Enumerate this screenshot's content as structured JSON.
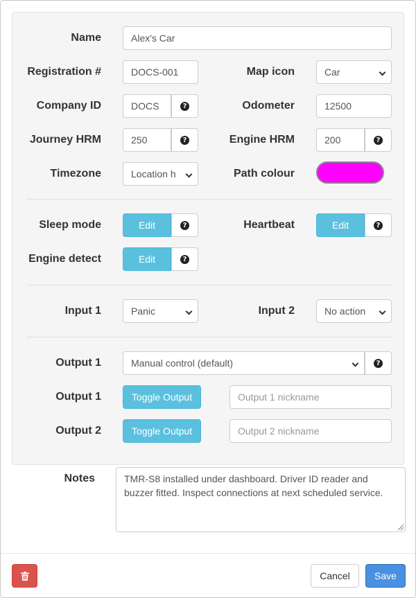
{
  "form": {
    "name": {
      "label": "Name",
      "value": "Alex's Car"
    },
    "registration": {
      "label": "Registration #",
      "value": "DOCS-001"
    },
    "map_icon": {
      "label": "Map icon",
      "selected": "Car"
    },
    "company_id": {
      "label": "Company ID",
      "value": "DOCS"
    },
    "odometer": {
      "label": "Odometer",
      "value": "12500"
    },
    "journey_hrm": {
      "label": "Journey HRM",
      "value": "250"
    },
    "engine_hrm": {
      "label": "Engine HRM",
      "value": "200"
    },
    "timezone": {
      "label": "Timezone",
      "selected": "Location h"
    },
    "path_colour": {
      "label": "Path colour",
      "color": "#ff00ff"
    },
    "sleep_mode": {
      "label": "Sleep mode",
      "button": "Edit"
    },
    "heartbeat": {
      "label": "Heartbeat",
      "button": "Edit"
    },
    "engine_detect": {
      "label": "Engine detect",
      "button": "Edit"
    },
    "input1": {
      "label": "Input 1",
      "selected": "Panic"
    },
    "input2": {
      "label": "Input 2",
      "selected": "No action"
    },
    "output1_mode": {
      "label": "Output 1",
      "selected": "Manual control (default)"
    },
    "output1_toggle": {
      "label": "Output 1",
      "button": "Toggle Output",
      "placeholder": "Output 1 nickname"
    },
    "output2_toggle": {
      "label": "Output 2",
      "button": "Toggle Output",
      "placeholder": "Output 2 nickname"
    },
    "help_glyph": "?",
    "notes": {
      "label": "Notes",
      "value": "TMR-S8 installed under dashboard. Driver ID reader and buzzer fitted. Inspect connections at next scheduled service."
    }
  },
  "footer": {
    "delete_icon": "trash-icon",
    "cancel_label": "Cancel",
    "save_label": "Save"
  },
  "colors": {
    "info": "#5bc0de",
    "primary": "#4a90e2",
    "danger": "#d9534f",
    "panel": "#f5f5f5"
  }
}
